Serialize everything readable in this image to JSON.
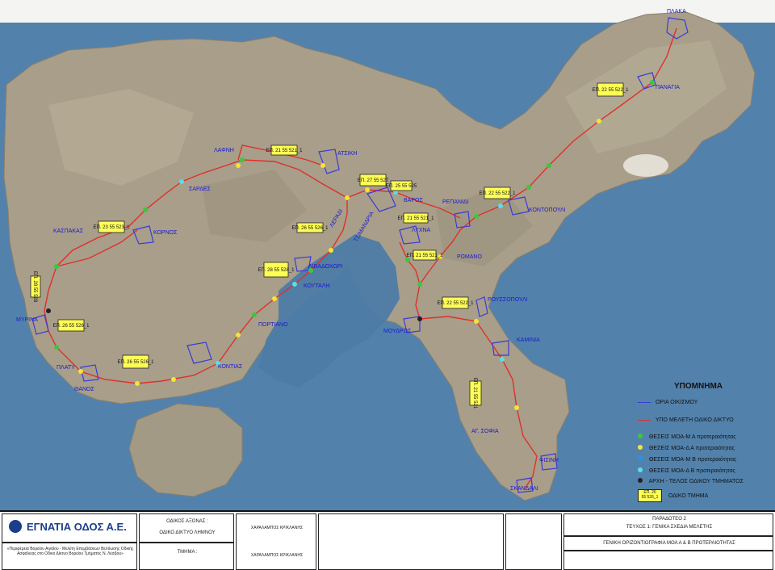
{
  "colors": {
    "sea": "#4d7ba6",
    "land": "#a89e8a",
    "road": "#e0302a",
    "settlement": "#3b3bd8",
    "moa_m_a": "#3cc83c",
    "moa_d_a": "#f2e632",
    "moa_m_b": "#2f8fe6",
    "moa_d_b": "#58e0e6",
    "segment_end": "#222222",
    "label_box": "#ffff55"
  },
  "settlements": [
    "ΠΛΑΚΑ",
    "ΠΑΝΑΓΙΑ",
    "ΛΑΦΝΗ",
    "ΑΤΣΙΚΗ",
    "ΣΑΡΔΕΣ",
    "ΒΑΡΟΣ",
    "ΡΕΠΑΝΙΔΙ",
    "ΚΟΝΤΟΠΟΥΛΙ",
    "ΚΑΣΠΑΚΑΣ",
    "ΚΟΡΝΟΣ",
    "ΛΥΧΝΑ",
    "ΡΩΜΑΝΟ",
    "ΛΙΒΑΔΟΧΩΡΙ",
    "ΛΕΡΑΔΙ",
    "ΤΣΙΜΑΝΔΡΙΑ",
    "ΚΟΥΤΑΛΗ",
    "ΡΟΥΣΣΟΠΟΥΛΙ",
    "ΠΟΡΤΙΑΝΟ",
    "ΜΥΡΙΝΑ",
    "ΜΟΥΔΡΟΣ",
    "ΚΑΜΙΝΙΑ",
    "ΠΛΑΤΥ",
    "ΚΟΝΤΙΑΣ",
    "ΘΑΝΟΣ",
    "ΑΓ. ΣΟΦΙΑ",
    "ΦΙΣΙΝΗ",
    "ΣΚΑΝΔΑΛΙ"
  ],
  "segment_labels": [
    "ΕΠ. 22 55 522_1",
    "ΕΠ. 21 55 521_1",
    "ΕΠ. 27 55 527",
    "ΕΠ. 25 55 525",
    "ΕΠ. 22 55 522_1",
    "ΕΠ. 21 55 521_1",
    "ΕΠ. 23 55 523_1",
    "ΕΠ. 26 55 526_1",
    "ΕΠ. 21 55 521_1",
    "ΕΠ. 28 55 528_1",
    "ΕΠ. 22 55 522_1",
    "ΕΠ. 26 55 526_1",
    "ΕΠ. 26 55 526_1",
    "ΕΠ. 21 55 521",
    "ΕΠ. 28 55 528"
  ],
  "legend": {
    "title": "ΥΠΟΜΝΗΜΑ",
    "items": [
      {
        "label": "ΟΡΙΑ ΟΙΚΙΣΜΟΥ",
        "symbol": "boundary"
      },
      {
        "label": "ΥΠΟ ΜΕΛΕΤΗ ΟΔΙΚΟ ΔΙΚΤΥΟ",
        "symbol": "road"
      },
      {
        "label": "ΘΕΣΕΙΣ ΜΟΑ-Μ  Α προτεραιότητας",
        "symbol": "dot-green"
      },
      {
        "label": "ΘΕΣΕΙΣ ΜΟΑ-Δ  Α προτεραιότητας",
        "symbol": "dot-yellow"
      },
      {
        "label": "ΘΕΣΕΙΣ ΜΟΑ-Μ  Β προτεραιότητας",
        "symbol": "dot-blue"
      },
      {
        "label": "ΘΕΣΕΙΣ ΜΟΑ-Δ  Β προτεραιότητας",
        "symbol": "dot-cyan"
      },
      {
        "label": "ΑΡΧΗ - ΤΕΛΟΣ ΟΔΙΚΟΥ ΤΜΗΜΑΤΟΣ",
        "symbol": "dot-black"
      },
      {
        "label": "ΟΔΙΚΟ ΤΜΗΜΑ",
        "symbol": "box",
        "box_line1": "ΕΠ. 26",
        "box_line2": "55 526_1"
      }
    ]
  },
  "title_block": {
    "logo": "ΕΓΝΑΤΙΑ ΟΔΟΣ Α.Ε.",
    "project": "«Περιφέρεια Βορείου Αιγαίου - Μελέτη Επεμβάσεων Βελτίωσης Οδικής Ασφάλειας στο Οδικό Δίκτυο Βορείου Τμήματος Ν. Λέσβου»",
    "axis_label": "ΟΔΙΚΟΣ ΑΞΟΝΑΣ :",
    "axis_value": "ΟΔΙΚΟ ΔΙΚΤΥΟ ΛΗΜΝΟΥ",
    "section_label": "ΤΜΗΜΑ :",
    "designer": "ΧΑΡΑΛΑΜΠΟΣ ΚΡΙΚΛΑΝΗΣ",
    "deliverable": "ΠΑΡΑΔΟΤΕΟ 2",
    "volume": "ΤΕΥΧΟΣ 1: ΓΕΝΙΚΑ ΣΧΕΔΙΑ ΜΕΛΕΤΗΣ",
    "drawing_title": "ΓΕΝΙΚΗ ΟΡΙΖΟΝΤΙΟΓΡΑΦΙΑ ΜΟΑ Α & Β ΠΡΟΤΕΡΑΙΟΤΗΤΑΣ"
  }
}
